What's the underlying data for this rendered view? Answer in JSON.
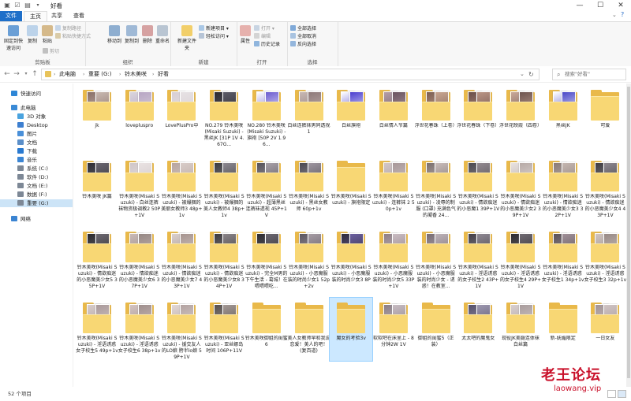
{
  "window": {
    "title": "好看",
    "minimize_label": "—",
    "maximize_label": "☐",
    "close_label": "✕"
  },
  "ribbon_tabs": [
    "文件",
    "主页",
    "共享",
    "查看"
  ],
  "ribbon": {
    "clipboard": {
      "pin_label": "固定到快速访问",
      "copy_label": "复制",
      "paste_label": "粘贴",
      "copy_path_label": "复制路径",
      "paste_shortcut_label": "粘贴快捷方式",
      "cut_label": "剪切",
      "group_label": "剪贴板"
    },
    "organize": {
      "move_to_label": "移动到",
      "copy_to_label": "复制到",
      "delete_label": "删除",
      "rename_label": "重命名",
      "group_label": "组织"
    },
    "new": {
      "new_folder_label": "新建文件夹",
      "new_item_label": "新建项目",
      "easy_access_label": "轻松访问",
      "group_label": "新建"
    },
    "open": {
      "properties_label": "属性",
      "open_label": "打开",
      "edit_label": "编辑",
      "history_label": "历史记录",
      "group_label": "打开"
    },
    "select": {
      "select_all_label": "全部选择",
      "select_none_label": "全部取消",
      "invert_label": "反向选择",
      "group_label": "选择"
    }
  },
  "address": {
    "crumbs": [
      "此电脑",
      "重要 (G:)",
      "铃木美咲",
      "好看"
    ]
  },
  "search": {
    "placeholder": "搜索\"好看\""
  },
  "nav": [
    {
      "label": "快速访问",
      "icon": "star-icon",
      "color": "#2e86d6",
      "indent": 0
    },
    {
      "label": "此电脑",
      "icon": "computer-icon",
      "color": "#3a8ad6",
      "indent": 0
    },
    {
      "label": "3D 对象",
      "icon": "cube-icon",
      "color": "#4aa3df",
      "indent": 1
    },
    {
      "label": "Desktop",
      "icon": "desktop-icon",
      "color": "#3d7fd0",
      "indent": 1
    },
    {
      "label": "图片",
      "icon": "picture-icon",
      "color": "#4a90d9",
      "indent": 1
    },
    {
      "label": "文档",
      "icon": "document-icon",
      "color": "#5b8fc9",
      "indent": 1
    },
    {
      "label": "下载",
      "icon": "download-icon",
      "color": "#2a7ad0",
      "indent": 1
    },
    {
      "label": "音乐",
      "icon": "music-icon",
      "color": "#3c86d4",
      "indent": 1
    },
    {
      "label": "系统 (C:)",
      "icon": "drive-icon",
      "color": "#7d8896",
      "indent": 1
    },
    {
      "label": "软件 (D:)",
      "icon": "drive-icon",
      "color": "#7d8896",
      "indent": 1
    },
    {
      "label": "文档 (E:)",
      "icon": "drive-icon",
      "color": "#7d8896",
      "indent": 1
    },
    {
      "label": "数据 (F:)",
      "icon": "drive-icon",
      "color": "#7d8896",
      "indent": 1
    },
    {
      "label": "重要 (G:)",
      "icon": "drive-icon",
      "color": "#7d8896",
      "indent": 1,
      "selected": true
    },
    {
      "label": "网络",
      "icon": "network-icon",
      "color": "#3b84d2",
      "indent": 0
    }
  ],
  "items": [
    {
      "label": "jk",
      "thumb": [
        "#8a7068",
        "#c8b8b0"
      ]
    },
    {
      "label": "loveplusprο",
      "thumb": [
        "#d9d4dc",
        "#b8a6c4"
      ]
    },
    {
      "label": "LovePlusPro中",
      "thumb": [
        "#d8cfd4",
        "#e6e1e3"
      ]
    },
    {
      "label": "NO.279 铃木美咲(Misaki Suzuki) - 黑丝JK [31P 1V 4.67G...",
      "thumb": [
        "#2c2a30",
        "#5b5a66"
      ]
    },
    {
      "label": "NO.280 铃木美咲(Misaki Suzuki) - 旗袍 [50P 2V 1.96...",
      "thumb": [
        "#ffffff",
        "#6b5bd0"
      ]
    },
    {
      "label": "白丝连裤袜男同透视1",
      "thumb": [
        "#c7b7b2",
        "#8e7a7a"
      ]
    },
    {
      "label": "白丝旗袍",
      "thumb": [
        "#ffffff",
        "#4b3fcf"
      ]
    },
    {
      "label": "白丝情人节篇",
      "thumb": [
        "#b59ea8",
        "#6b5560"
      ]
    },
    {
      "label": "浮世花春珠（上卷）",
      "thumb": [
        "#7d5f54",
        "#c8a590"
      ]
    },
    {
      "label": "浮世花春珠（下卷）",
      "thumb": [
        "#6b4f4a",
        "#b99484"
      ]
    },
    {
      "label": "浮世花映霞（四卷）",
      "thumb": [
        "#c9a898",
        "#6e5550"
      ]
    },
    {
      "label": "黑丝JK",
      "thumb": [
        "#ffffff",
        "#4a48c8"
      ]
    },
    {
      "label": "可爱",
      "thumb": [],
      "plain": true
    },
    {
      "label": "铃木美咲 JK篇",
      "thumb": [
        "#2f2e35",
        "#6a6670"
      ]
    },
    {
      "label": "铃木美咲(Misaki Suzuki) - 白丝连裤袜物资极调教2 50P+1V",
      "thumb": [
        "#cfc6c8",
        "#e9e2e2"
      ]
    },
    {
      "label": "铃木美咲(Misaki Suzuki) - 被爆捆的美丽女教师3 48p+1v",
      "thumb": [
        "#b7a59f",
        "#d8ccc8"
      ]
    },
    {
      "label": "铃木美咲(Misaki Suzuki) - 被爆捆的美人女教师4 38p+1v",
      "thumb": [
        "#3a3a3e",
        "#8c8890"
      ]
    },
    {
      "label": "铃木美咲(Misaki Suzuki) - 超薄黑丝连裤袜透视 45P+1V",
      "thumb": [
        "#55525a",
        "#a8a0a8"
      ]
    },
    {
      "label": "铃木美咲(Misaki Suzuki) - 黑丝女教师 60p+1v",
      "thumb": [
        "#4a4850",
        "#9e96a0"
      ]
    },
    {
      "label": "铃木美咲(Misaki Suzuki) - 旗袍限定",
      "thumb": [],
      "plain": true
    },
    {
      "label": "铃木美咲(Misaki Suzuki) - 连裤袜 2 50p+1v",
      "thumb": [
        "#d2c7c8",
        "#a89899"
      ]
    },
    {
      "label": "铃木美咲(Misaki Suzuki) - 凌辱的制服 (口罩) 充满色气的凝香 24...",
      "thumb": [
        "#7a6f6e",
        "#c9bcba"
      ]
    },
    {
      "label": "铃木美咲(Misaki Suzuki) - 情欲痴迷的小恶魔1 39P+1V",
      "thumb": [
        "#4c4a50",
        "#938a90"
      ]
    },
    {
      "label": "铃木美咲(Misaki Suzuki) - 情欲痴迷的小恶魔美少女2 39P+1V",
      "thumb": [
        "#e8e2e0",
        "#b7aaa6"
      ]
    },
    {
      "label": "铃木美咲(Misaki Suzuki) - 情欲痴迷的小恶魔美少女3 32P+1V",
      "thumb": [
        "#8a7c78",
        "#c4b6b0"
      ]
    },
    {
      "label": "铃木美咲(Misaki Suzuki) - 情欲痴迷的小恶魔美少女4 43P+1V",
      "thumb": [
        "#3e3c42",
        "#8e8890"
      ]
    },
    {
      "label": "铃木美咲(Misaki Suzuki) - 情欲痴迷的小恶魔美少女5 35P+1V",
      "thumb": [
        "#2a2a2e",
        "#6c6870"
      ]
    },
    {
      "label": "铃木美咲(Misaki Suzuki) - 情欲痴迷的小恶魔美少女6 37P+1V",
      "thumb": [
        "#c9b9b6",
        "#968884"
      ]
    },
    {
      "label": "铃木美咲(Misaki Suzuki) - 情欲痴迷的小恶魔美少女7 43P+1V",
      "thumb": [
        "#d9cfcc",
        "#a6948f"
      ]
    },
    {
      "label": "铃木美咲(Misaki Suzuki) - 情欲痴迷的小恶魔美少女8 34P+1V",
      "thumb": [
        "#3c3a3e",
        "#8a8488"
      ]
    },
    {
      "label": "铃木美咲(Misaki Suzuki) - 完全M男的下午生活 - 葛城！在喂喂喂吃...",
      "thumb": [
        "#2c2b31",
        "#6a6670"
      ]
    },
    {
      "label": "铃木美咲(Misaki Suzuki) - 小恶魔服装的时尚少女1 52p+2v",
      "thumb": [
        "#5b5660",
        "#a69ca4"
      ]
    },
    {
      "label": "铃木美咲(Misaki Suzuki) - 小恶魔服装的时尚少女3 8P",
      "thumb": [
        "#2f2c3a",
        "#6b5fa0"
      ]
    },
    {
      "label": "铃木美咲(Misaki Suzuki) - 小恶魔服装的时尚少女5 33P+1V",
      "thumb": [
        "#8f7f86",
        "#c9bcc2"
      ]
    },
    {
      "label": "铃木美咲(Misaki Suzuki) - 小恶魔服装的时尚少女 - 诱惑！在教室...",
      "thumb": [
        "#776c74",
        "#bdb2b8"
      ]
    },
    {
      "label": "铃木美咲(Misaki Suzuki) - 淫语诱惑的女子校生2 43P+1V",
      "thumb": [
        "#433f47",
        "#8e8892"
      ]
    },
    {
      "label": "铃木美咲(Misaki Suzuki) - 淫语诱惑的女子校生4 29P+1V",
      "thumb": [
        "#2c2b2f",
        "#706a72"
      ]
    },
    {
      "label": "铃木美咲(Misaki Suzuki) - 淫语诱惑女子校生1 34p+1v",
      "thumb": [
        "#5a5258",
        "#a09098"
      ]
    },
    {
      "label": "铃木美咲(Misaki Suzuki) - 淫语诱惑女子校生3 32p+1v",
      "thumb": [
        "#cfc4c0",
        "#988a86"
      ]
    },
    {
      "label": "铃木美咲(Misaki Suzuki) - 淫语诱惑女子校生5 49p+1v",
      "thumb": [
        "#d8cdcb",
        "#a9999a"
      ]
    },
    {
      "label": "铃木美咲(Misaki Suzuki) - 淫语诱惑女子校生6 38p+1v",
      "thumb": [
        "#d4c4c2",
        "#9e8e8c"
      ]
    },
    {
      "label": "铃木美咲(Misaki Suzuki) - 援交友人的LO娘 胯半lo娘 59P+1V",
      "thumb": [
        "#e2d8d6",
        "#b2a2a0"
      ]
    },
    {
      "label": "铃木美咲(Misaki Suzuki) - 亚丝娜岛时间 106P+11V",
      "thumb": [
        "#56504e",
        "#a39894"
      ]
    },
    {
      "label": "铃木美咲御姐的闺蜜6",
      "thumb": [],
      "plain": true
    },
    {
      "label": "美人女教师早和我说恋爱！美人的吧！(复百道)",
      "thumb": [],
      "plain": true
    },
    {
      "label": "魔女的考验3v",
      "thumb": [],
      "plain": true,
      "selected": true
    },
    {
      "label": "软软吧在床里上 - 8分钟2W 1V",
      "thumb": [
        "#8a7e86",
        "#c7bcc2"
      ]
    },
    {
      "label": "御姐的闺蜜5（正装）",
      "thumb": [],
      "plain": true
    },
    {
      "label": "太太吧的魔鬼女",
      "thumb": [
        "#55506a",
        "#9d98b0"
      ]
    },
    {
      "label": "现役JK美腿连体袜 白丝篇",
      "thumb": [
        "#d9d0d0",
        "#a89c9c"
      ]
    },
    {
      "label": "新-妩媚限定",
      "thumb": [],
      "plain": true
    },
    {
      "label": "一日女友",
      "thumb": [
        "#a29496",
        "#d0c4c4"
      ]
    }
  ],
  "status": {
    "count": "52 个项目"
  },
  "watermark": {
    "line1": "老王论坛",
    "line2": "laowang.vip"
  },
  "colors": {
    "accent": "#1e6fc9",
    "folder": "#f8d774",
    "selection": "#cce8ff"
  }
}
